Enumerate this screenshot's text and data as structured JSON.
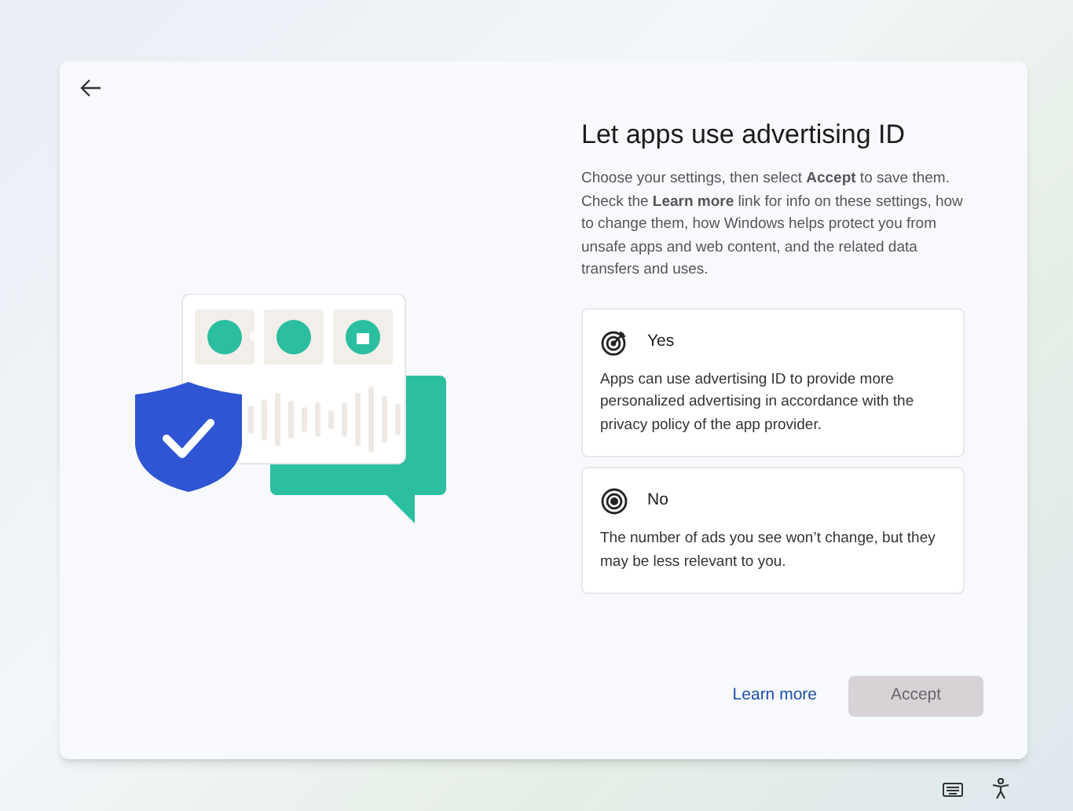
{
  "title": "Let apps use advertising ID",
  "description": "Choose your settings, then select **Accept** to save them. Check the **Learn more** link for info on these settings, how to change them, how Windows helps protect you from unsafe apps and web content, and the related data transfers and uses.",
  "options": [
    {
      "kind": "target",
      "label": "Yes",
      "text": "Apps can use advertising ID to provide more personalized advertising in accordance with the privacy policy of the app provider.",
      "selected": false
    },
    {
      "kind": "radio",
      "label": "No",
      "text": "The number of ads you see won’t change, but they may be less relevant to you.",
      "selected": false
    }
  ],
  "learn_more": "Learn more",
  "accept": {
    "label": "Accept",
    "disabled": true
  }
}
